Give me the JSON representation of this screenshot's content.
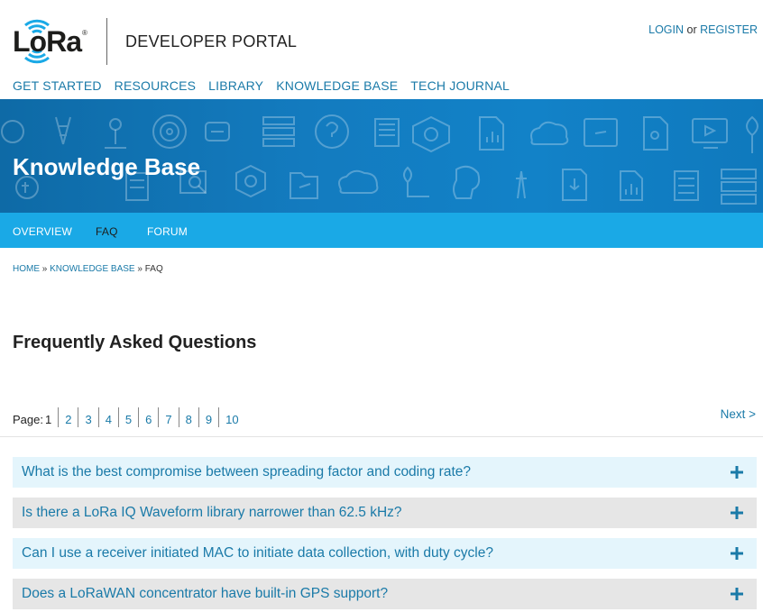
{
  "header": {
    "logo_text": "LoRa",
    "logo_reg": "®",
    "portal_title": "DEVELOPER PORTAL",
    "auth": {
      "login": "LOGIN",
      "or": " or ",
      "register": "REGISTER"
    }
  },
  "topnav": [
    {
      "label": "GET STARTED"
    },
    {
      "label": "RESOURCES"
    },
    {
      "label": "LIBRARY"
    },
    {
      "label": "KNOWLEDGE BASE"
    },
    {
      "label": "TECH JOURNAL"
    }
  ],
  "hero": {
    "title": "Knowledge Base"
  },
  "subnav": [
    {
      "label": "OVERVIEW",
      "active": false
    },
    {
      "label": "FAQ",
      "active": true
    },
    {
      "label": "FORUM",
      "active": false
    }
  ],
  "breadcrumb": {
    "home": "HOME",
    "sep": " » ",
    "kb": "KNOWLEDGE BASE",
    "current": "FAQ"
  },
  "page_heading": "Frequently Asked Questions",
  "pagination": {
    "label": "Page:",
    "pages": [
      "1",
      "2",
      "3",
      "4",
      "5",
      "6",
      "7",
      "8",
      "9",
      "10"
    ],
    "current": "1",
    "next": "Next >"
  },
  "faq_items": [
    {
      "question": "What is the best compromise between spreading factor and coding rate?"
    },
    {
      "question": "Is there a LoRa IQ Waveform library narrower than 62.5 kHz?"
    },
    {
      "question": "Can I use a receiver initiated MAC to initiate data collection, with duty cycle?"
    },
    {
      "question": "Does a LoRaWAN concentrator have built-in GPS support?"
    }
  ],
  "colors": {
    "link": "#1a7aa8",
    "hero_blue": "#137bbf",
    "subnav_blue": "#1aa9e6",
    "faq_light": "#e4f5fc",
    "faq_grey": "#e6e6e6"
  }
}
